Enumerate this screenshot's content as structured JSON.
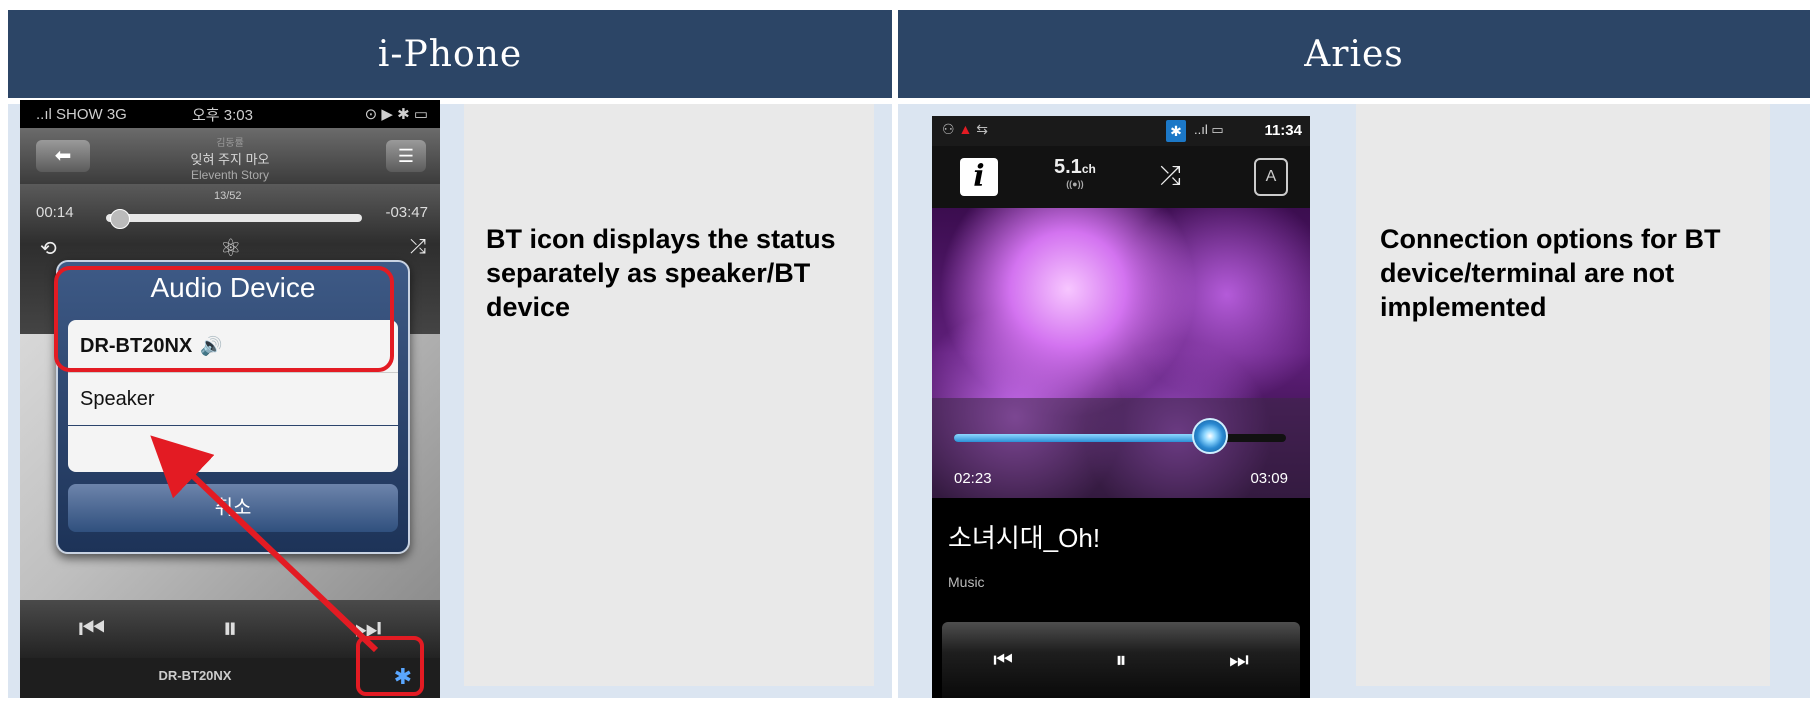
{
  "columns": {
    "left_title": "i-Phone",
    "right_title": "Aries"
  },
  "iphone": {
    "status": {
      "carrier": "..ıl SHOW  3G",
      "time": "오후 3:03",
      "icons": "⊙ ▶ ✱ ▭"
    },
    "nav": {
      "back": "⬅",
      "artist": "김동률",
      "song": "잊혀 주지 마오",
      "album": "Eleventh Story",
      "menu": "☰"
    },
    "progress": {
      "track_count": "13/52",
      "elapsed": "00:14",
      "remaining": "-03:47",
      "fraction": 0.05
    },
    "controls_row1": {
      "repeat": "⟲",
      "genius": "⚛",
      "shuffle": "⤮"
    },
    "dialog": {
      "title": "Audio Device",
      "option_bt": "DR-BT20NX",
      "option_bt_icon": "speaker-icon",
      "option_speaker": "Speaker",
      "cancel": "취소"
    },
    "transport": {
      "prev": "⏮",
      "pause": "⏸",
      "next": "⏭"
    },
    "bottom": {
      "device": "DR-BT20NX",
      "bt_icon": "✱"
    }
  },
  "aries": {
    "status": {
      "left_icons": "⚇",
      "warn": "▲",
      "usb": "⇆",
      "bt": "✱",
      "signal": "..ıl ▭",
      "time": "11:34"
    },
    "toolbar": {
      "info": "i",
      "surround": "5.1",
      "surround_unit": "ch",
      "surround_sub": "((●))",
      "shuffle": "⤮",
      "rotate": "A"
    },
    "progress": {
      "elapsed": "02:23",
      "total": "03:09",
      "fraction": 0.77
    },
    "song": "소녀시대_Oh!",
    "category": "Music",
    "transport": {
      "prev": "⏮",
      "pause": "⏸",
      "next": "⏭"
    }
  },
  "descriptions": {
    "left": "BT icon displays the status separately as speaker/BT device",
    "right": "Connection options for BT device/terminal are not implemented"
  },
  "colors": {
    "header": "#2c4566",
    "panel": "#dbe5f1",
    "highlight": "#e31b23",
    "accent_blue": "#2c8fd6"
  }
}
